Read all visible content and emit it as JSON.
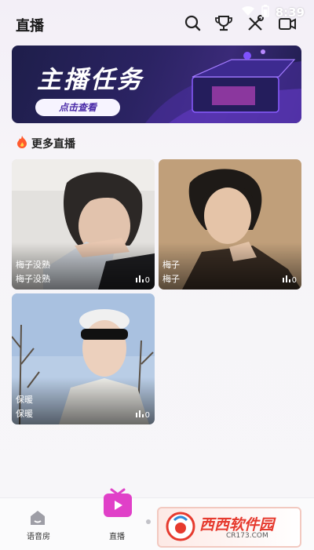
{
  "status": {
    "time": "8:39"
  },
  "header": {
    "title": "直播"
  },
  "banner": {
    "title": "主播任务",
    "button_label": "点击查看"
  },
  "section": {
    "title": "更多直播"
  },
  "cards": [
    {
      "title": "梅子没熟",
      "host": "梅子没熟",
      "viewers": "0"
    },
    {
      "title": "梅子",
      "host": "梅子",
      "viewers": "0"
    },
    {
      "title": "保暖",
      "host": "保暖",
      "viewers": "0"
    }
  ],
  "nav": [
    {
      "label": "语音房",
      "icon": "home-icon"
    },
    {
      "label": "直播",
      "icon": "tv-icon"
    }
  ],
  "watermark": {
    "text": "西西软件园",
    "sub": "CR173.COM"
  }
}
